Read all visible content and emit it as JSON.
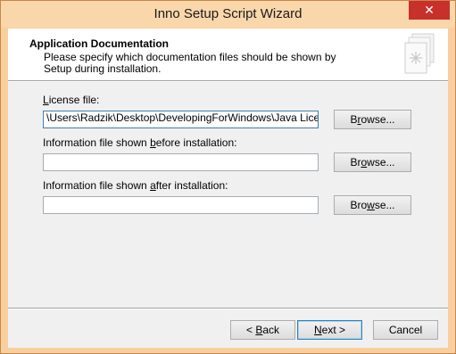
{
  "window": {
    "title": "Inno Setup Script Wizard",
    "close_glyph": "✕"
  },
  "header": {
    "title": "Application Documentation",
    "description": "Please specify which documentation files should be shown by Setup during installation.",
    "icon": "document-wizard-icon"
  },
  "fields": {
    "license": {
      "label_pre": "",
      "label_key": "L",
      "label_post": "icense file:",
      "value": "\\Users\\Radzik\\Desktop\\DevelopingForWindows\\Java License.txt",
      "browse_pre": "B",
      "browse_key": "r",
      "browse_post": "owse..."
    },
    "before": {
      "label_pre": "Information file shown ",
      "label_key": "b",
      "label_post": "efore installation:",
      "value": "",
      "browse_pre": "Br",
      "browse_key": "o",
      "browse_post": "wse..."
    },
    "after": {
      "label_pre": "Information file shown ",
      "label_key": "a",
      "label_post": "fter installation:",
      "value": "",
      "browse_pre": "Bro",
      "browse_key": "w",
      "browse_post": "se..."
    }
  },
  "footer": {
    "back_pre": "< ",
    "back_key": "B",
    "back_post": "ack",
    "next_pre": "",
    "next_key": "N",
    "next_post": "ext >",
    "cancel": "Cancel"
  }
}
